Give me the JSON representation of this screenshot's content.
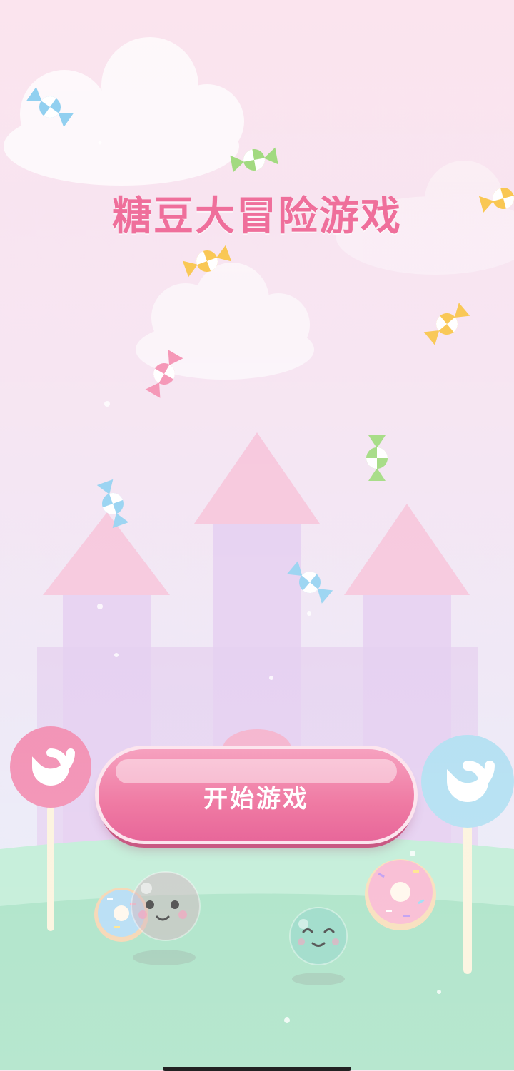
{
  "game": {
    "title": "糖豆大冒险游戏",
    "start_button": "开始游戏"
  },
  "colors": {
    "title": "#ef6f9b",
    "button": "#ef7aa3",
    "castle_roof": "#f6c3da",
    "castle_wall": "#e2c9ee",
    "grass": "#9fdfbf",
    "lollipop_pink": "#f07fa8",
    "lollipop_blue": "#a8dbf0"
  },
  "decorations": {
    "candy_icons": [
      "candy-blue",
      "candy-green",
      "candy-orange",
      "candy-orange",
      "candy-orange",
      "candy-pink",
      "candy-green",
      "candy-blue",
      "candy-blue"
    ],
    "lollipop_icons": [
      "lollipop-pink",
      "lollipop-blue"
    ],
    "donut_icons": [
      "donut-blue",
      "donut-pink"
    ],
    "character_icons": [
      "bean-character-pink",
      "bean-character-green"
    ]
  }
}
